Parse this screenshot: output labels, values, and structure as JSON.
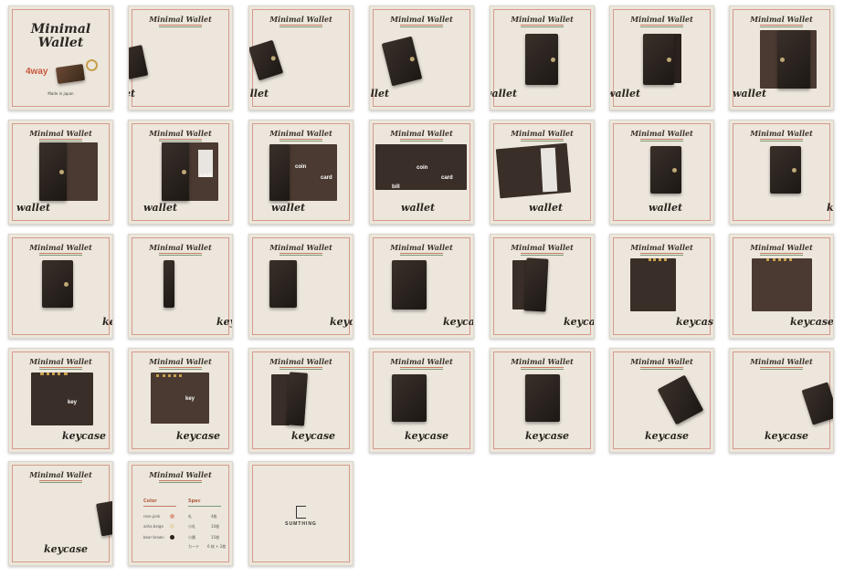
{
  "brand": "Minimal Wallet",
  "cover": {
    "title_line1": "Minimal",
    "title_line2": "Wallet",
    "ways": "4way",
    "made": "Made in japan"
  },
  "cards": [
    {
      "word": "wallet"
    },
    {
      "word": "wallet"
    },
    {
      "word": "wallet"
    },
    {
      "word": "wallet"
    },
    {
      "word": "wallet"
    },
    {
      "word": "wallet"
    },
    {
      "word": "wallet"
    },
    {
      "word": "wallet"
    },
    {
      "word": "wallet"
    },
    {
      "word": "wallet"
    },
    {
      "word": "wallet"
    },
    {
      "word": "wallet"
    },
    {
      "word": "key"
    },
    {
      "word": "key"
    },
    {
      "word": "keycase"
    },
    {
      "word": "keycase"
    },
    {
      "word": "keycase"
    },
    {
      "word": "keycase"
    },
    {
      "word": "keycase"
    },
    {
      "word": "keycase"
    },
    {
      "word": "keycase"
    },
    {
      "word": "keycase"
    },
    {
      "word": "keycase"
    },
    {
      "word": "keycase"
    },
    {
      "word": "keycase"
    },
    {
      "word": "keycase"
    },
    {
      "word": "keycase"
    }
  ],
  "labels": {
    "coin": "coin",
    "card": "card",
    "bill": "bill",
    "key": "key"
  },
  "spec": {
    "color_title": "Color",
    "spec_title": "Spec",
    "colors": [
      {
        "name": "rose pink",
        "hex": "#e0a08a",
        "spec": "札",
        "count": "4枚"
      },
      {
        "name": "asha beige",
        "hex": "#e8d7b4",
        "spec": "小札",
        "count": "10枚"
      },
      {
        "name": "bear brown",
        "hex": "#2a221d",
        "spec": "小銭",
        "count": "15枚"
      }
    ],
    "extra_spec": "カード",
    "extra_count": "6 枚 + 2枚"
  },
  "logo": "SUMTHING"
}
